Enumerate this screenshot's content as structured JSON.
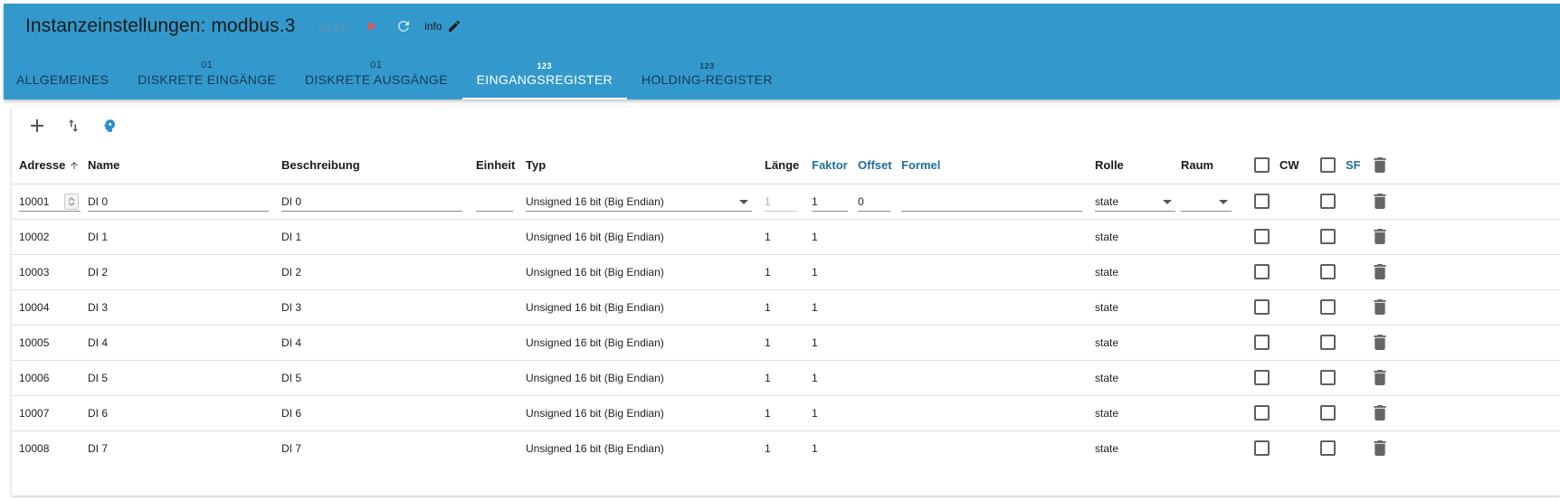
{
  "header": {
    "title": "Instanzeinstellungen: modbus.3",
    "version": "v6.1.0",
    "icons": {
      "play": "play-icon",
      "reload": "reload-icon",
      "edit": "pencil-icon"
    },
    "info_label": "info",
    "colors": {
      "appbar": "#3399cc",
      "play": "#e05a4f"
    }
  },
  "tabs": [
    {
      "top": "",
      "label": "ALLGEMEINES"
    },
    {
      "top": "01",
      "label": "DISKRETE EINGÄNGE"
    },
    {
      "top": "01",
      "label": "DISKRETE AUSGÄNGE"
    },
    {
      "top": "123",
      "label": "EINGANGSREGISTER",
      "active": true
    },
    {
      "top": "123",
      "label": "HOLDING-REGISTER"
    }
  ],
  "toolbar": {
    "icons": [
      "add-icon",
      "sort-icon",
      "head-icon"
    ]
  },
  "table": {
    "columns": {
      "adresse": "Adresse",
      "name": "Name",
      "beschreibung": "Beschreibung",
      "einheit": "Einheit",
      "typ": "Typ",
      "laenge": "Länge",
      "faktor": "Faktor",
      "offset": "Offset",
      "formel": "Formel",
      "rolle": "Rolle",
      "raum": "Raum",
      "cw": "CW",
      "sf": "SF"
    },
    "edit_row": {
      "adresse": "10001",
      "name": "DI 0",
      "beschreibung": "DI 0",
      "einheit": "",
      "typ": "Unsigned 16 bit (Big Endian)",
      "laenge": "1",
      "faktor": "1",
      "offset": "0",
      "formel": "",
      "rolle": "state",
      "raum": ""
    },
    "rows": [
      {
        "adresse": "10002",
        "name": "DI 1",
        "beschreibung": "DI 1",
        "typ": "Unsigned 16 bit (Big Endian)",
        "laenge": "1",
        "faktor": "1",
        "rolle": "state"
      },
      {
        "adresse": "10003",
        "name": "DI 2",
        "beschreibung": "DI 2",
        "typ": "Unsigned 16 bit (Big Endian)",
        "laenge": "1",
        "faktor": "1",
        "rolle": "state"
      },
      {
        "adresse": "10004",
        "name": "DI 3",
        "beschreibung": "DI 3",
        "typ": "Unsigned 16 bit (Big Endian)",
        "laenge": "1",
        "faktor": "1",
        "rolle": "state"
      },
      {
        "adresse": "10005",
        "name": "DI 4",
        "beschreibung": "DI 4",
        "typ": "Unsigned 16 bit (Big Endian)",
        "laenge": "1",
        "faktor": "1",
        "rolle": "state"
      },
      {
        "adresse": "10006",
        "name": "DI 5",
        "beschreibung": "DI 5",
        "typ": "Unsigned 16 bit (Big Endian)",
        "laenge": "1",
        "faktor": "1",
        "rolle": "state"
      },
      {
        "adresse": "10007",
        "name": "DI 6",
        "beschreibung": "DI 6",
        "typ": "Unsigned 16 bit (Big Endian)",
        "laenge": "1",
        "faktor": "1",
        "rolle": "state"
      },
      {
        "adresse": "10008",
        "name": "DI 7",
        "beschreibung": "DI 7",
        "typ": "Unsigned 16 bit (Big Endian)",
        "laenge": "1",
        "faktor": "1",
        "rolle": "state"
      }
    ]
  }
}
